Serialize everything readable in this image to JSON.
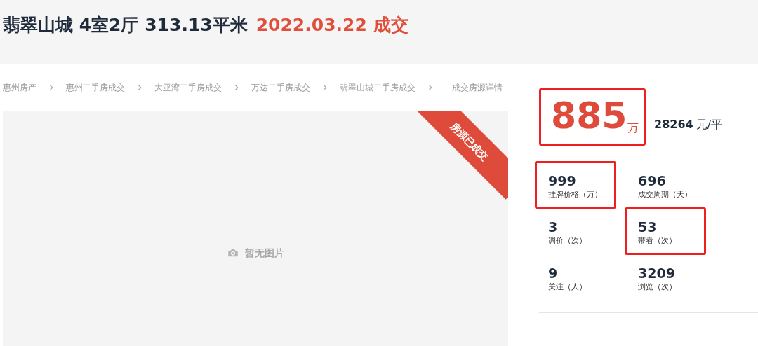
{
  "header": {
    "name": "翡翠山城 4室2厅 313.13平米",
    "deal": "2022.03.22 成交"
  },
  "breadcrumb": [
    "惠州房产",
    "惠州二手房成交",
    "大亚湾二手房成交",
    "万达二手房成交",
    "翡翠山城二手房成交",
    "成交房源详情"
  ],
  "photo": {
    "ribbon": "房源已成交",
    "empty_label": "暂无图片"
  },
  "price": {
    "total": "885",
    "unit": "万",
    "highlighted": true,
    "per_area": "28264",
    "per_area_unit": "元/平"
  },
  "stats": [
    {
      "value": "999",
      "label": "挂牌价格（万）",
      "highlighted": true
    },
    {
      "value": "696",
      "label": "成交周期（天）",
      "highlighted": false
    },
    {
      "value": "3",
      "label": "调价（次）",
      "highlighted": false
    },
    {
      "value": "53",
      "label": "带看（次）",
      "highlighted": true
    },
    {
      "value": "9",
      "label": "关注（人）",
      "highlighted": false
    },
    {
      "value": "3209",
      "label": "浏览（次）",
      "highlighted": false
    }
  ]
}
